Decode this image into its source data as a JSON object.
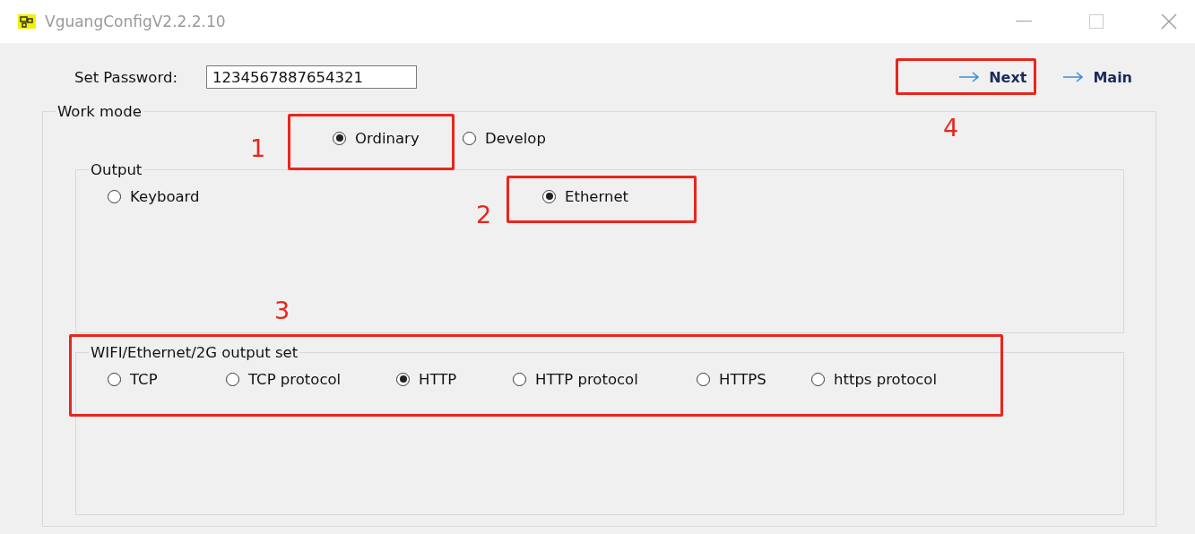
{
  "window": {
    "title": "VguangConfigV2.2.2.10"
  },
  "password": {
    "label": "Set Password:",
    "value": "1234567887654321"
  },
  "links": [
    {
      "label": "Next"
    },
    {
      "label": "Main"
    }
  ],
  "work_mode": {
    "title": "Work mode",
    "options": [
      {
        "label": "Ordinary",
        "selected": true
      },
      {
        "label": "Develop",
        "selected": false
      }
    ]
  },
  "output": {
    "title": "Output",
    "options": [
      {
        "label": "Keyboard",
        "selected": false
      },
      {
        "label": "Ethernet",
        "selected": true
      }
    ]
  },
  "network_output": {
    "title": "WIFI/Ethernet/2G output set",
    "options": [
      {
        "label": "TCP",
        "selected": false
      },
      {
        "label": "TCP protocol",
        "selected": false
      },
      {
        "label": "HTTP",
        "selected": true
      },
      {
        "label": "HTTP protocol",
        "selected": false
      },
      {
        "label": "HTTPS",
        "selected": false
      },
      {
        "label": "https protocol",
        "selected": false
      }
    ]
  },
  "annotations": [
    {
      "label": "1"
    },
    {
      "label": "2"
    },
    {
      "label": "3"
    },
    {
      "label": "4"
    }
  ]
}
